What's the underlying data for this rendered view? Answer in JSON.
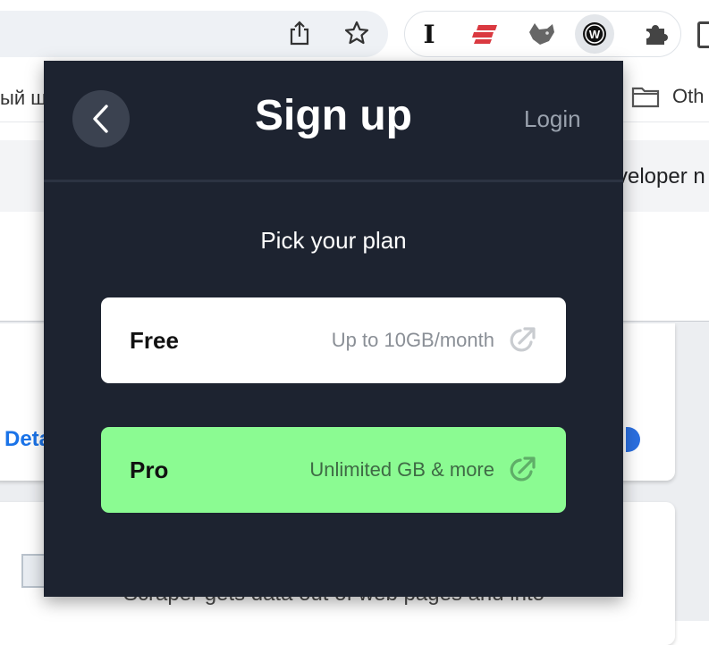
{
  "browser": {
    "extensions": [
      {
        "name": "i-cursor-extension-icon",
        "glyph": "I"
      },
      {
        "name": "expressvpn-extension-icon"
      },
      {
        "name": "fox-extension-icon"
      },
      {
        "name": "webscraper-extension-icon",
        "glyph": "W",
        "active": true
      }
    ],
    "bookmarks": {
      "left_text": "ый ш",
      "right_folder": "Oth"
    }
  },
  "background_page": {
    "heading_fragment": "veloper n",
    "details_link": "Deta",
    "description_fragment": "Scraper gets data out of web pages and into"
  },
  "popup": {
    "title": "Sign up",
    "login_label": "Login",
    "subtitle": "Pick your plan",
    "plans": [
      {
        "name": "Free",
        "description": "Up to 10GB/month",
        "bg": "#ffffff"
      },
      {
        "name": "Pro",
        "description": "Unlimited GB & more",
        "bg": "#8bfb92"
      }
    ]
  },
  "colors": {
    "popup_bg": "#1d2330",
    "pro_accent": "#8bfb92",
    "link_blue": "#1a73e8"
  }
}
